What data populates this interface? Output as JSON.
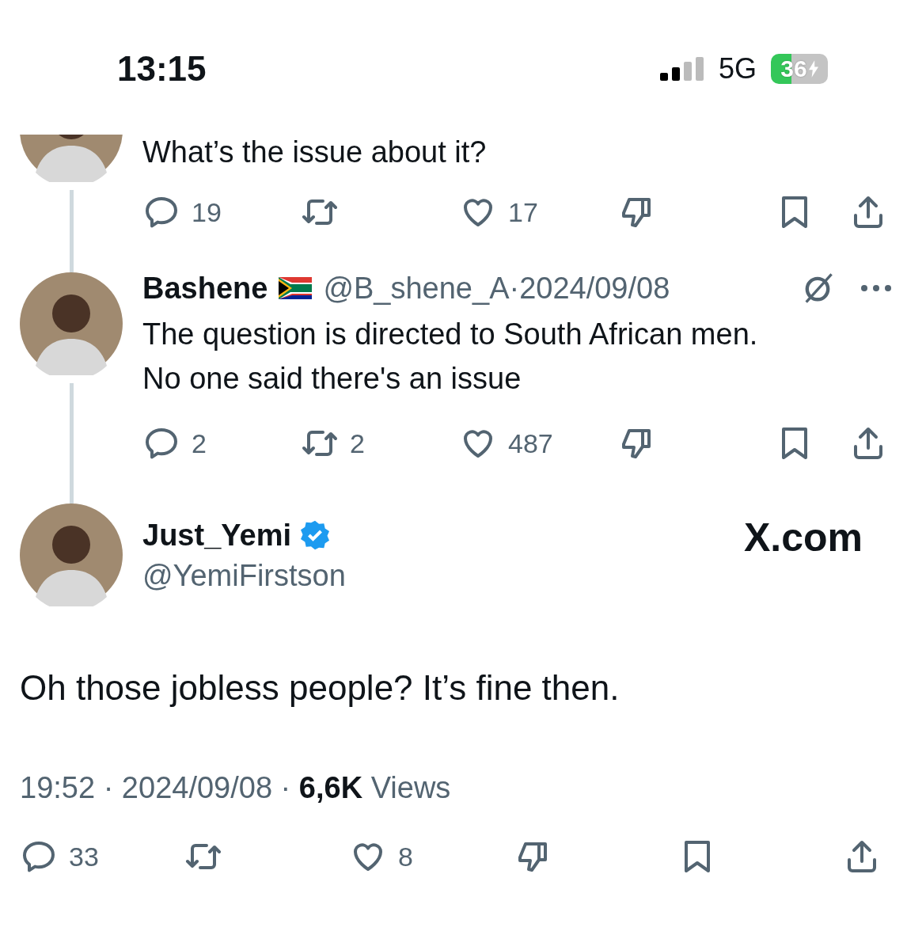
{
  "status_bar": {
    "time": "13:15",
    "network": "5G",
    "battery": "36",
    "charging": true
  },
  "replies": [
    {
      "kind": "partial",
      "text": "What’s the issue about it?",
      "actions": [
        {
          "kind": "reply",
          "count": "19"
        },
        {
          "kind": "repost"
        },
        {
          "kind": "like",
          "count": "17"
        },
        {
          "kind": "dislike"
        },
        {
          "kind": "bookmark"
        },
        {
          "kind": "share"
        }
      ]
    },
    {
      "kind": "full",
      "name": "Bashene",
      "flag": true,
      "handle": "@B_shene_A",
      "separator": "·",
      "date": "2024/09/08",
      "text": "The question is directed to South African men. No one said there's an issue",
      "actions": [
        {
          "kind": "reply",
          "count": "2"
        },
        {
          "kind": "repost",
          "count": "2"
        },
        {
          "kind": "like",
          "count": "487"
        },
        {
          "kind": "dislike"
        },
        {
          "kind": "bookmark"
        },
        {
          "kind": "share"
        }
      ]
    }
  ],
  "main_post": {
    "name": "Just_Yemi",
    "verified": true,
    "handle": "@YemiFirstson",
    "watermark": "X.com",
    "text": "Oh those jobless people? It’s fine then.",
    "time": "19:52",
    "separator": "·",
    "date": "2024/09/08",
    "views_count": "6,6K",
    "views_label": "Views",
    "actions": [
      {
        "kind": "reply",
        "count": "33"
      },
      {
        "kind": "repost"
      },
      {
        "kind": "like",
        "count": "8"
      },
      {
        "kind": "dislike"
      },
      {
        "kind": "bookmark"
      },
      {
        "kind": "share"
      }
    ]
  }
}
